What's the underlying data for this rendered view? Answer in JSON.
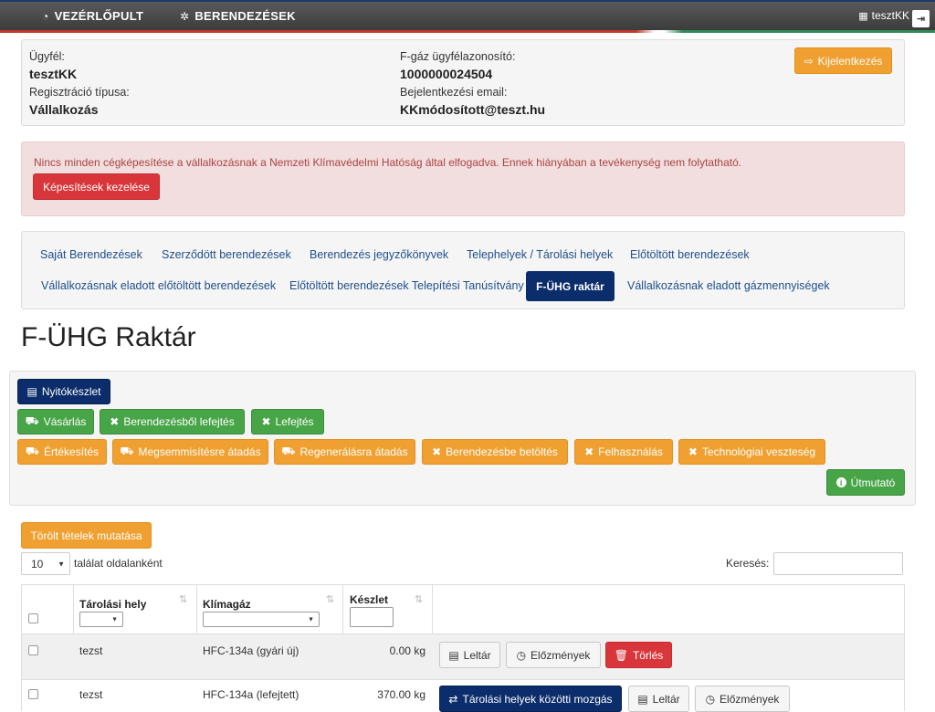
{
  "nav": {
    "dashboard": "VEZÉRLŐPULT",
    "equipment": "BERENDEZÉSEK",
    "user": "tesztKK"
  },
  "client": {
    "client_label": "Ügyfél:",
    "client_value": "tesztKK",
    "reg_type_label": "Regisztráció típusa:",
    "reg_type_value": "Vállalkozás",
    "fgas_id_label": "F-gáz ügyfélazonosító:",
    "fgas_id_value": "1000000024504",
    "email_label": "Bejelentkezési email:",
    "email_value": "KKmódosított@teszt.hu",
    "logout_button": "Kijelentkezés"
  },
  "alert": {
    "message": "Nincs minden cégképesítése a vállalkozásnak a Nemzeti Klímavédelmi Hatóság által elfogadva. Ennek hiányában a tevékenység nem folytatható.",
    "button": "Képesítések kezelése"
  },
  "tabs": {
    "own_equipment": "Saját Berendezések",
    "contracted_equipment": "Szerződött berendezések",
    "equipment_logs": "Berendezés jegyzőkönyvek",
    "sites": "Telephelyek / Tárolási helyek",
    "prefilled": "Előtöltött berendezések",
    "sold_prefilled": "Vállalkozásnak eladott előtöltött berendezések",
    "prefilled_install_cert": "Előtöltött berendezések Telepítési Tanúsítvány",
    "fuhg_storage": "F-ÜHG raktár",
    "sold_gas": "Vállalkozásnak eladott gázmennyiségek"
  },
  "page_title": "F-ÜHG Raktár",
  "actions": {
    "opening_stock": "Nyitókészlet",
    "purchase": "Vásárlás",
    "drain_from_equipment": "Berendezésből lefejtés",
    "drain": "Lefejtés",
    "sale": "Értékesítés",
    "for_destruction": "Megsemmisítésre átadás",
    "for_regeneration": "Regenerálásra átadás",
    "fill_into_equipment": "Berendezésbe betöltés",
    "usage": "Felhasználás",
    "tech_loss": "Technológiai veszteség",
    "guide": "Útmutató"
  },
  "table_controls": {
    "show_deleted": "Törölt tételek mutatása",
    "page_size": "10",
    "page_size_label": "találat oldalanként",
    "search_label": "Keresés:"
  },
  "table": {
    "headers": {
      "storage": "Tárolási hely",
      "gas": "Klímagáz",
      "stock": "Készlet"
    },
    "rows": [
      {
        "storage": "tezst",
        "gas": "HFC-134a (gyári új)",
        "stock": "0.00 kg",
        "buttons": {
          "inventory": "Leltár",
          "history": "Előzmények",
          "delete": "Törlés"
        }
      },
      {
        "storage": "tezst",
        "gas": "HFC-134a (lefejtett)",
        "stock": "370.00 kg",
        "buttons": {
          "move": "Tárolási helyek közötti mozgás",
          "inventory": "Leltár",
          "history": "Előzmények"
        }
      }
    ]
  },
  "colors": {
    "navy": "#0c2d6b",
    "orange": "#f0a030",
    "green": "#47a447",
    "red": "#d9363b",
    "alert_bg": "#f2dede"
  }
}
